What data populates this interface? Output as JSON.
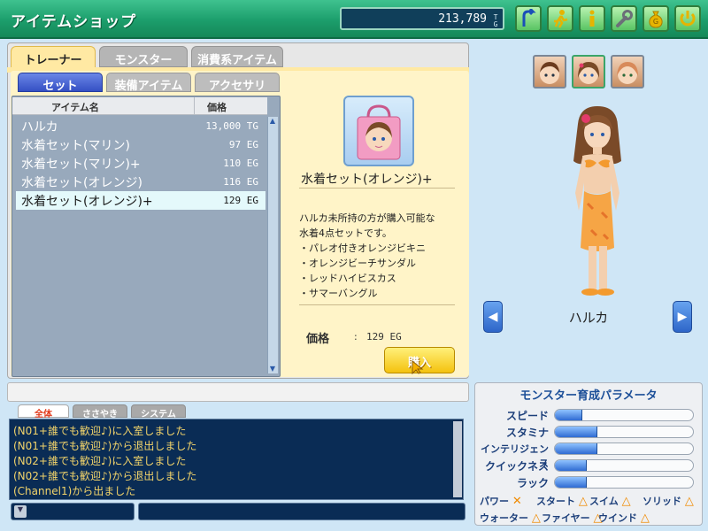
{
  "window": {
    "title": "アイテムショップ",
    "money": "213,789",
    "money_unit_top": "T",
    "money_unit_bottom": "G"
  },
  "top_icons": [
    {
      "name": "back-icon"
    },
    {
      "name": "run-icon"
    },
    {
      "name": "info-icon"
    },
    {
      "name": "wrench-icon"
    },
    {
      "name": "money-bag-icon"
    },
    {
      "name": "power-icon"
    }
  ],
  "tabs_primary": [
    {
      "label": "トレーナー",
      "active": true
    },
    {
      "label": "モンスター",
      "active": false
    },
    {
      "label": "消費系アイテム",
      "active": false
    }
  ],
  "tabs_secondary": [
    {
      "label": "セット",
      "active": true
    },
    {
      "label": "装備アイテム",
      "active": false
    },
    {
      "label": "アクセサリ",
      "active": false
    }
  ],
  "item_list": {
    "header_name": "アイテム名",
    "header_price": "価格",
    "rows": [
      {
        "name": "ハルカ",
        "price": "13,000 TG",
        "selected": false
      },
      {
        "name": "水着セット(マリン)",
        "price": "97 EG",
        "selected": false
      },
      {
        "name": "水着セット(マリン)+",
        "price": "110 EG",
        "selected": false
      },
      {
        "name": "水着セット(オレンジ)",
        "price": "116 EG",
        "selected": false
      },
      {
        "name": "水着セット(オレンジ)+",
        "price": "129 EG",
        "selected": true
      }
    ]
  },
  "detail": {
    "title": "水着セット(オレンジ)+",
    "description": [
      "ハルカ未所持の方が購入可能な",
      "水着4点セットです。",
      "・パレオ付きオレンジビキニ",
      "・オレンジビーチサンダル",
      "・レッドハイビスカス",
      "・サマーバングル"
    ],
    "price_label": "価格",
    "price_colon": ":",
    "price_value": "129 EG",
    "buy_label": "購入"
  },
  "character": {
    "name": "ハルカ",
    "selected_portrait": 1
  },
  "chat": {
    "tabs": [
      {
        "label": "全体",
        "active": true
      },
      {
        "label": "ささやき",
        "active": false
      },
      {
        "label": "システム",
        "active": false
      }
    ],
    "lines": [
      "(N01+誰でも歓迎♪)に入室しました",
      "(N01+誰でも歓迎♪)から退出しました",
      "(N02+誰でも歓迎♪)に入室しました",
      "(N02+誰でも歓迎♪)から退出しました",
      "(Channel1)から出ました"
    ]
  },
  "params": {
    "title": "モンスター育成パラメータ",
    "stats": [
      {
        "label": "スピード",
        "value": 0.2
      },
      {
        "label": "スタミナ",
        "value": 0.31
      },
      {
        "label": "インテリジェンス",
        "value": 0.31
      },
      {
        "label": "クイックネス",
        "value": 0.23
      },
      {
        "label": "ラック",
        "value": 0.23
      }
    ],
    "attributes": [
      {
        "label": "パワー",
        "symbol": "✕"
      },
      {
        "label": "スタート",
        "symbol": "△"
      },
      {
        "label": "スイム",
        "symbol": "△"
      },
      {
        "label": "ソリッド",
        "symbol": "△"
      },
      {
        "label": "ウォーター",
        "symbol": "△"
      },
      {
        "label": "ファイヤー",
        "symbol": "△"
      },
      {
        "label": "ウインド",
        "symbol": "△"
      }
    ]
  }
}
